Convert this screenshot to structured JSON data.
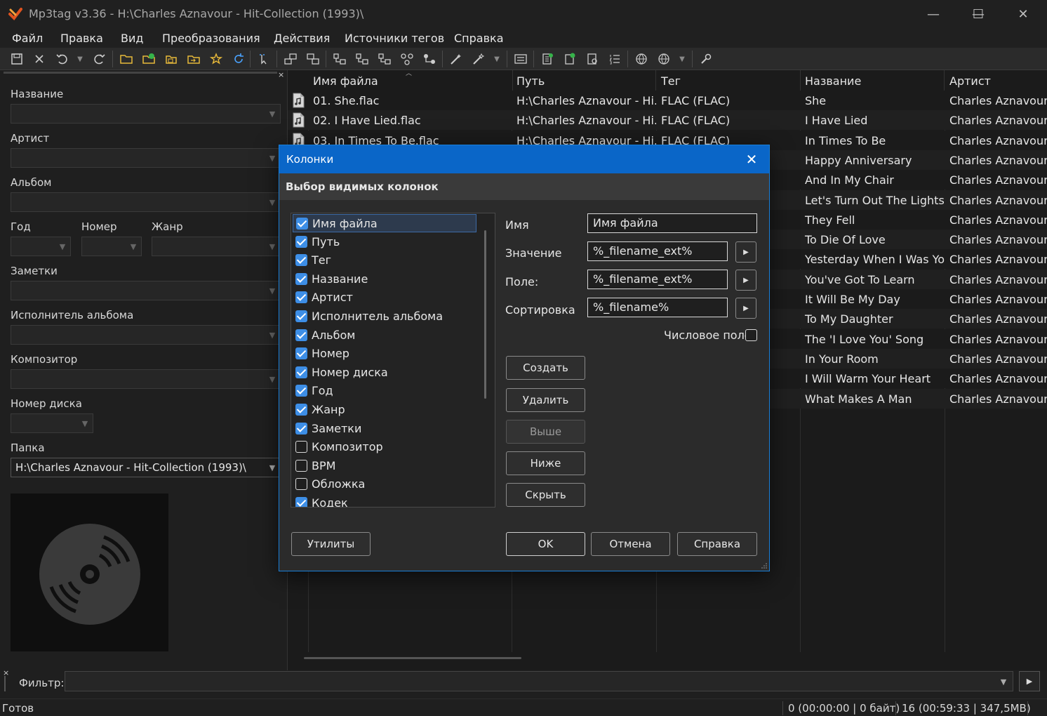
{
  "window": {
    "title": "Mp3tag v3.36  -  H:\\Charles Aznavour - Hit-Collection (1993)\\",
    "minimize_glyph": "—",
    "maximize_glyph": "☐",
    "close_glyph": "✕"
  },
  "menu": [
    "Файл",
    "Правка",
    "Вид",
    "Преобразования",
    "Действия",
    "Источники тегов",
    "Справка"
  ],
  "left_panel": {
    "labels": {
      "title": "Название",
      "artist": "Артист",
      "album": "Альбом",
      "year": "Год",
      "track": "Номер",
      "genre": "Жанр",
      "comment": "Заметки",
      "album_artist": "Исполнитель альбома",
      "composer": "Композитор",
      "disc": "Номер диска",
      "folder": "Папка"
    },
    "folder_value": "H:\\Charles Aznavour - Hit-Collection (1993)\\"
  },
  "filelist": {
    "headers": [
      "Имя файла",
      "Путь",
      "Тег",
      "Название",
      "Артист"
    ],
    "rows": [
      {
        "file": "01. She.flac",
        "path": "H:\\Charles Aznavour - Hi...",
        "tag": "FLAC (FLAC)",
        "title": "She",
        "artist": "Charles Aznavour"
      },
      {
        "file": "02. I Have Lied.flac",
        "path": "H:\\Charles Aznavour - Hi...",
        "tag": "FLAC (FLAC)",
        "title": "I Have Lied",
        "artist": "Charles Aznavour"
      },
      {
        "file": "03. In Times To Be.flac",
        "path": "H:\\Charles Aznavour - Hi...",
        "tag": "FLAC (FLAC)",
        "title": "In Times To Be",
        "artist": "Charles Aznavour"
      },
      {
        "file": "",
        "path": "",
        "tag": "",
        "title": "Happy Anniversary",
        "artist": "Charles Aznavour"
      },
      {
        "file": "",
        "path": "",
        "tag": "",
        "title": "And In My Chair",
        "artist": "Charles Aznavour"
      },
      {
        "file": "",
        "path": "",
        "tag": "",
        "title": "Let's Turn Out The Lights",
        "artist": "Charles Aznavour"
      },
      {
        "file": "",
        "path": "",
        "tag": "",
        "title": "They Fell",
        "artist": "Charles Aznavour"
      },
      {
        "file": "",
        "path": "",
        "tag": "",
        "title": "To Die Of Love",
        "artist": "Charles Aznavour"
      },
      {
        "file": "",
        "path": "",
        "tag": "",
        "title": "Yesterday When I Was Yo...",
        "artist": "Charles Aznavour"
      },
      {
        "file": "",
        "path": "",
        "tag": "",
        "title": "You've Got To Learn",
        "artist": "Charles Aznavour"
      },
      {
        "file": "",
        "path": "",
        "tag": "",
        "title": "It Will Be My Day",
        "artist": "Charles Aznavour"
      },
      {
        "file": "",
        "path": "",
        "tag": "",
        "title": "To My Daughter",
        "artist": "Charles Aznavour"
      },
      {
        "file": "",
        "path": "",
        "tag": "",
        "title": "The 'I Love You' Song",
        "artist": "Charles Aznavour"
      },
      {
        "file": "",
        "path": "",
        "tag": "",
        "title": "In Your Room",
        "artist": "Charles Aznavour"
      },
      {
        "file": "",
        "path": "",
        "tag": "",
        "title": "I Will Warm Your Heart",
        "artist": "Charles Aznavour"
      },
      {
        "file": "",
        "path": "",
        "tag": "",
        "title": "What Makes A Man",
        "artist": "Charles Aznavour"
      }
    ]
  },
  "filter": {
    "label": "Фильтр:",
    "value": ""
  },
  "status": {
    "left": "Готов",
    "selected": "0 (00:00:00 | 0 байт)",
    "total": "16 (00:59:33 | 347,5МВ)"
  },
  "dialog": {
    "title": "Колонки",
    "subtitle": "Выбор видимых колонок",
    "columns": [
      {
        "label": "Имя файла",
        "checked": true
      },
      {
        "label": "Путь",
        "checked": true
      },
      {
        "label": "Тег",
        "checked": true
      },
      {
        "label": "Название",
        "checked": true
      },
      {
        "label": "Артист",
        "checked": true
      },
      {
        "label": "Исполнитель альбома",
        "checked": true
      },
      {
        "label": "Альбом",
        "checked": true
      },
      {
        "label": "Номер",
        "checked": true
      },
      {
        "label": "Номер диска",
        "checked": true
      },
      {
        "label": "Год",
        "checked": true
      },
      {
        "label": "Жанр",
        "checked": true
      },
      {
        "label": "Заметки",
        "checked": true
      },
      {
        "label": "Композитор",
        "checked": false
      },
      {
        "label": "BPM",
        "checked": false
      },
      {
        "label": "Обложка",
        "checked": false
      },
      {
        "label": "Кодек",
        "checked": true
      }
    ],
    "fields": {
      "name_label": "Имя",
      "name_value": "Имя файла",
      "value_label": "Значение",
      "value_value": "%_filename_ext%",
      "field_label": "Поле:",
      "field_value": "%_filename_ext%",
      "sort_label": "Сортировка",
      "sort_value": "%_filename%",
      "numeric_label": "Числовое поле"
    },
    "buttons": {
      "create": "Создать",
      "delete": "Удалить",
      "up": "Выше",
      "down": "Ниже",
      "hide": "Скрыть",
      "utilities": "Утилиты",
      "ok": "OK",
      "cancel": "Отмена",
      "help": "Справка"
    }
  }
}
